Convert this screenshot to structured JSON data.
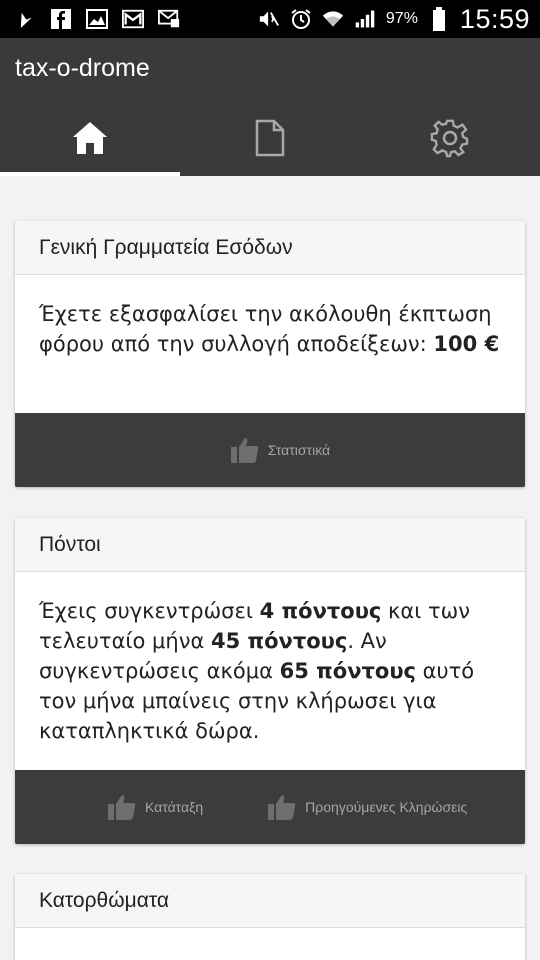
{
  "status_bar": {
    "battery": "97%",
    "time": "15:59",
    "icons": [
      "navigation-icon",
      "facebook-icon",
      "gallery-icon",
      "gmail-icon",
      "email-icon",
      "mute-icon",
      "alarm-icon",
      "wifi-icon",
      "signal-icon",
      "battery-icon"
    ]
  },
  "app": {
    "title": "tax-o-drome",
    "tabs": [
      {
        "name": "home",
        "icon": "home-icon",
        "selected": true
      },
      {
        "name": "documents",
        "icon": "document-icon",
        "selected": false
      },
      {
        "name": "settings",
        "icon": "gear-icon",
        "selected": false
      }
    ]
  },
  "cards": {
    "revenue": {
      "title": "Γενική Γραμματεία Εσόδων",
      "text": "Έχετε εξασφαλίσει την ακόλουθη έκπτωση φόρου από την συλλογή αποδείξεων: ",
      "amount": "100 €",
      "button": "Στατιστικά"
    },
    "points": {
      "title": "Πόντοι",
      "t1": "Έχεις συγκεντρώσει ",
      "b1": "4 πόντους",
      "t2": " και των τελευταίο μήνα ",
      "b2": "45 πόντους",
      "t3": ". Αν συγκεντρώσεις ακόμα ",
      "b3": "65 πόντους",
      "t4": " αυτό τον μήνα μπαίνεις στην κλήρωσει για καταπληκτικά δώρα.",
      "button_ranking": "Κατάταξη",
      "button_previous": "Προηγούμενες Κληρώσεις"
    },
    "achievements": {
      "title": "Κατορθώματα"
    }
  },
  "colors": {
    "appbar": "#3a3a3a",
    "card_footer": "#3c3c3c",
    "footer_text": "#a5a5a5"
  }
}
